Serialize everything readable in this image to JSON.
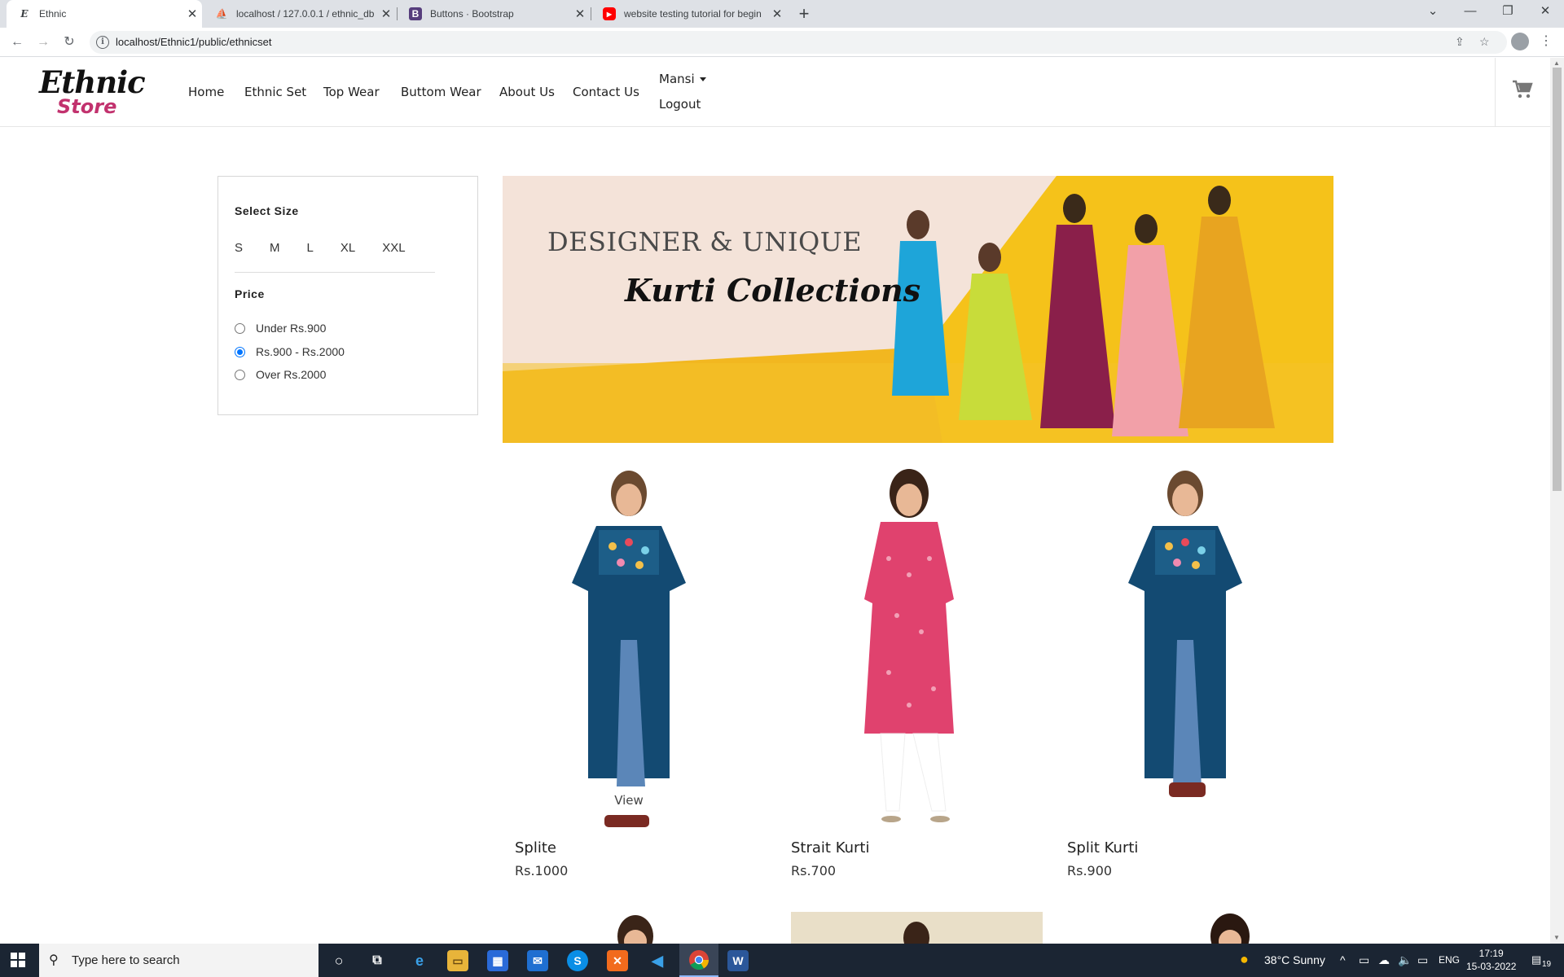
{
  "browser": {
    "tabs": [
      {
        "title": "Ethnic",
        "favicon": "ethnic-favicon",
        "active": true
      },
      {
        "title": "localhost / 127.0.0.1 / ethnic_db",
        "favicon": "phpmyadmin-favicon",
        "active": false
      },
      {
        "title": "Buttons · Bootstrap",
        "favicon": "bootstrap-favicon",
        "active": false
      },
      {
        "title": "website testing tutorial for begin",
        "favicon": "youtube-favicon",
        "active": false
      }
    ],
    "url": "localhost/Ethnic1/public/ethnicset"
  },
  "site": {
    "logo_line1": "Ethnic",
    "logo_line2": "Store",
    "nav": [
      "Home",
      "Ethnic Set",
      "Top Wear",
      "Buttom Wear",
      "About Us",
      "Contact Us"
    ],
    "user_name": "Mansi",
    "logout": "Logout",
    "brand_color": "#c2326e"
  },
  "filters": {
    "size_heading": "Select Size",
    "sizes": [
      "S",
      "M",
      "L",
      "XL",
      "XXL"
    ],
    "price_heading": "Price",
    "price_options": [
      {
        "label": "Under Rs.900",
        "selected": false
      },
      {
        "label": "Rs.900 - Rs.2000",
        "selected": true
      },
      {
        "label": "Over Rs.2000",
        "selected": false
      }
    ]
  },
  "banner": {
    "line1": "DESIGNER & UNIQUE",
    "line2": "Kurti Collections"
  },
  "products": [
    {
      "name": "Splite",
      "price": "Rs.1000",
      "hover_label": "View",
      "color": "#134a72"
    },
    {
      "name": "Strait Kurti",
      "price": "Rs.700",
      "color": "#e0426e"
    },
    {
      "name": "Split Kurti",
      "price": "Rs.900",
      "color": "#134a72"
    }
  ],
  "taskbar": {
    "search_placeholder": "Type here to search",
    "weather": "38°C  Sunny",
    "language": "ENG",
    "time": "17:19",
    "date": "15-03-2022",
    "notification_count": "19"
  }
}
